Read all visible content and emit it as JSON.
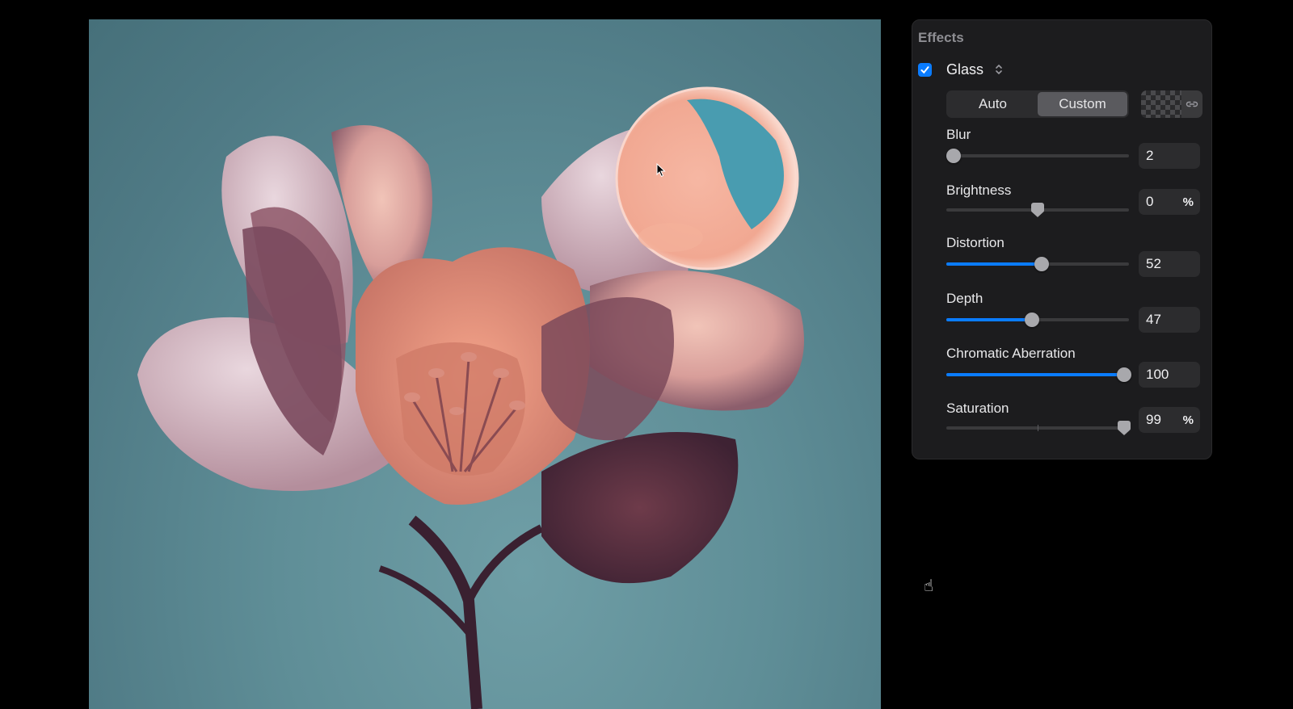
{
  "panel": {
    "title": "Effects",
    "glass": {
      "label": "Glass",
      "checked": true
    },
    "mode_options": [
      "Auto",
      "Custom"
    ],
    "selected_mode": "Custom",
    "sliders": [
      {
        "label": "Blur",
        "value": "2",
        "unit": "",
        "fraction": 0.02
      },
      {
        "label": "Brightness",
        "value": "0",
        "unit": "%",
        "fraction": 0.5
      },
      {
        "label": "Distortion",
        "value": "52",
        "unit": "",
        "fraction": 0.52
      },
      {
        "label": "Depth",
        "value": "47",
        "unit": "",
        "fraction": 0.47
      },
      {
        "label": "Chromatic Aberration",
        "value": "100",
        "unit": "",
        "fraction": 1.0
      },
      {
        "label": "Saturation",
        "value": "99",
        "unit": "%",
        "fraction": 0.995
      }
    ]
  },
  "colors": {
    "accent": "#0a7cff",
    "panel_bg": "#1c1c1e",
    "canvas_bg": "#5f8e97",
    "petal": "#e8a494"
  },
  "icons": [
    "checkmark-icon",
    "chevron-updown-icon",
    "checkerboard-icon",
    "link-icon",
    "arrow-cursor-icon",
    "hand-cursor-icon"
  ]
}
